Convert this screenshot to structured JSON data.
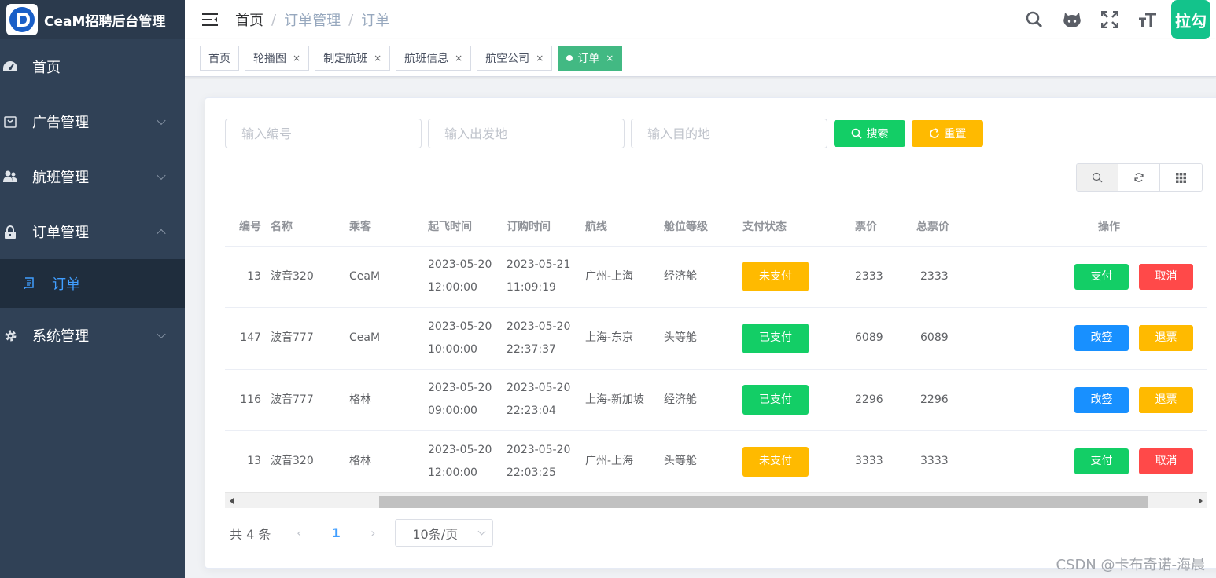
{
  "app": {
    "title": "CeaM招聘后台管理"
  },
  "sidebar": {
    "items": [
      {
        "label": "首页",
        "icon": "dashboard-icon"
      },
      {
        "label": "广告管理",
        "icon": "shopping-icon"
      },
      {
        "label": "航班管理",
        "icon": "peoples-icon"
      },
      {
        "label": "订单管理",
        "icon": "lock-icon"
      },
      {
        "label": "系统管理",
        "icon": "gear-icon"
      }
    ],
    "subitem": {
      "label": "订单",
      "icon": "document-icon"
    }
  },
  "breadcrumb": {
    "first": "首页",
    "second": "订单管理",
    "third": "订单",
    "sep": "/"
  },
  "header": {
    "avatar_text": "拉勾"
  },
  "tags": {
    "home": "首页",
    "t1": "轮播图",
    "t2": "制定航班",
    "t3": "航班信息",
    "t4": "航空公司",
    "active": "订单",
    "close": "×"
  },
  "search": {
    "no_placeholder": "输入编号",
    "from_placeholder": "输入出发地",
    "to_placeholder": "输入目的地",
    "search_label": "搜索",
    "reset_label": "重置"
  },
  "table": {
    "headers": {
      "id": "编号",
      "name": "名称",
      "passenger": "乘客",
      "depart": "起飞时间",
      "order_time": "订购时间",
      "route": "航线",
      "cabin": "舱位等级",
      "pay_status": "支付状态",
      "price": "票价",
      "total": "总票价",
      "ops": "操作"
    },
    "rows": [
      {
        "id": "13",
        "name": "波音320",
        "passenger": "CeaM",
        "depart": "2023-05-20 12:00:00",
        "order_time": "2023-05-21 11:09:19",
        "route": "广州-上海",
        "cabin": "经济舱",
        "status": "未支付",
        "price": "2333",
        "total": "2333",
        "op1": "支付",
        "op2": "取消"
      },
      {
        "id": "147",
        "name": "波音777",
        "passenger": "CeaM",
        "depart": "2023-05-20 10:00:00",
        "order_time": "2023-05-20 22:37:37",
        "route": "上海-东京",
        "cabin": "头等舱",
        "status": "已支付",
        "price": "6089",
        "total": "6089",
        "op1": "改签",
        "op2": "退票"
      },
      {
        "id": "116",
        "name": "波音777",
        "passenger": "格林",
        "depart": "2023-05-20 09:00:00",
        "order_time": "2023-05-20 22:23:04",
        "route": "上海-新加坡",
        "cabin": "经济舱",
        "status": "已支付",
        "price": "2296",
        "total": "2296",
        "op1": "改签",
        "op2": "退票"
      },
      {
        "id": "13",
        "name": "波音320",
        "passenger": "格林",
        "depart": "2023-05-20 12:00:00",
        "order_time": "2023-05-20 22:03:25",
        "route": "广州-上海",
        "cabin": "头等舱",
        "status": "未支付",
        "price": "3333",
        "total": "3333",
        "op1": "支付",
        "op2": "取消"
      }
    ]
  },
  "pager": {
    "total": "共 4 条",
    "current": "1",
    "size": "10条/页"
  },
  "watermark": "CSDN @卡布奇诺-海晨",
  "colors": {
    "sidebar_bg": "#304156",
    "active_tag": "#42b983",
    "success": "#13ce66",
    "warning": "#ffba00",
    "danger": "#ff4949",
    "primary": "#1890ff"
  }
}
